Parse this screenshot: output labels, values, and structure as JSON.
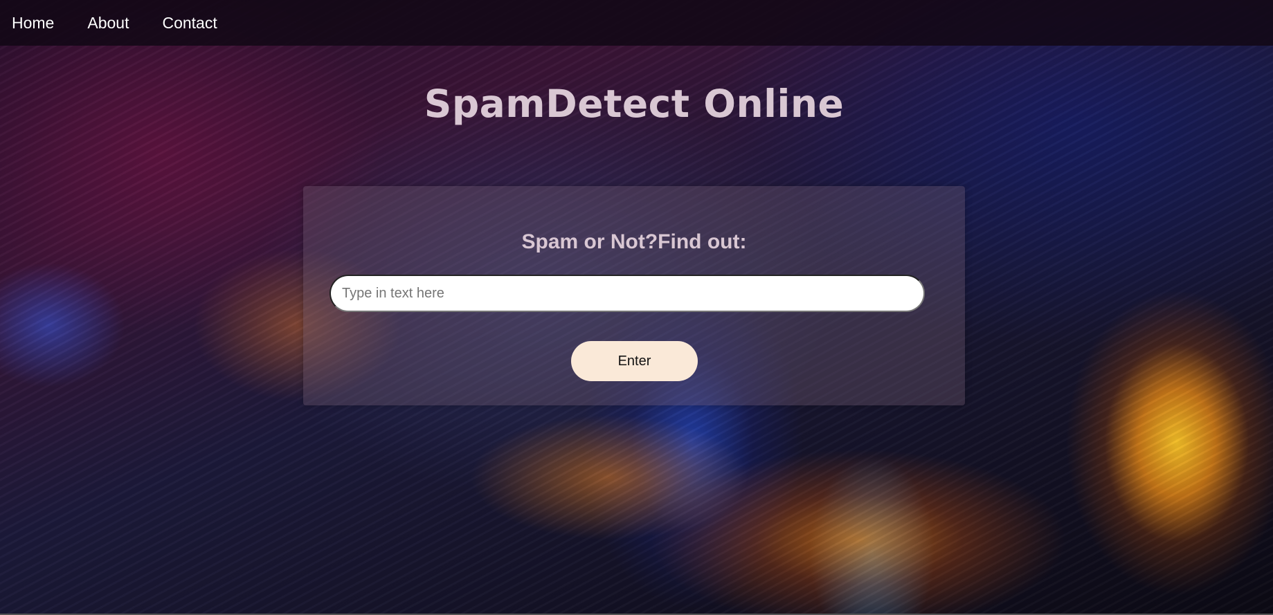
{
  "nav": {
    "items": [
      {
        "label": "Home"
      },
      {
        "label": "About"
      },
      {
        "label": "Contact"
      }
    ]
  },
  "main": {
    "title": "SpamDetect Online"
  },
  "form": {
    "heading": "Spam or Not?Find out:",
    "input_placeholder": "Type in text here",
    "input_value": "",
    "submit_label": "Enter"
  },
  "colors": {
    "title_text": "#d9c7d3",
    "button_bg": "#fae9d8",
    "navbar_bg": "#120816"
  }
}
